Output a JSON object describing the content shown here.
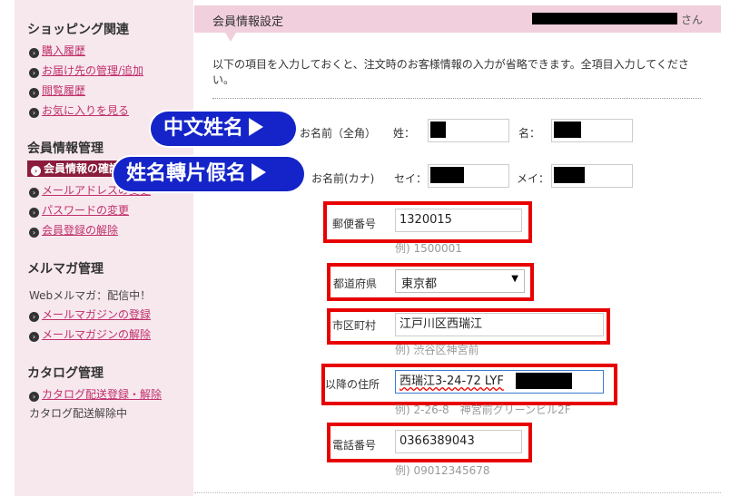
{
  "sidebar": {
    "shopping_title": "ショッピング関連",
    "shopping_links": [
      "購入履歴",
      "お届け先の管理/追加",
      "閲覧履歴",
      "お気に入りを見る"
    ],
    "member_title": "会員情報管理",
    "member_active": "会員情報の確認",
    "member_links": [
      "メールアドレスの変更",
      "パスワードの変更",
      "会員登録の解除"
    ],
    "mailmag_title": "メルマガ管理",
    "mailmag_status": "Webメルマガ：配信中！",
    "mailmag_links": [
      "メールマガジンの登録",
      "メールマガジンの解除"
    ],
    "catalog_title": "カタログ管理",
    "catalog_links": [
      "カタログ配送登録・解除"
    ],
    "catalog_status": "カタログ配送解除中"
  },
  "header": {
    "title": "会員情報設定",
    "san": "さん"
  },
  "intro": "以下の項目を入力しておくと、注文時のお客様情報の入力が省略できます。全項目入力してください。",
  "form": {
    "name_kanji": {
      "label": "お名前（全角）",
      "sei_label": "姓：",
      "mei_label": "名："
    },
    "name_kana": {
      "label": "お名前(カナ)",
      "sei_label": "セイ：",
      "mei_label": "メイ："
    },
    "postal": {
      "label": "郵便番号",
      "value": "1320015",
      "hint": "例) 1500001"
    },
    "prefecture": {
      "label": "都道府県",
      "value": "東京都"
    },
    "city": {
      "label": "市区町村",
      "value": "江戸川区西瑞江",
      "hint": "例) 渋谷区神宮前"
    },
    "address": {
      "label": "以降の住所",
      "value": "西瑞江3-24-72 LYF",
      "hint": "例) 2-26-8　神宮前グリーンビル2F"
    },
    "phone": {
      "label": "電話番号",
      "value": "0366389043",
      "hint": "例) 09012345678"
    }
  },
  "callouts": {
    "chinese_name": "中文姓名",
    "kana_name": "姓名轉片假名"
  },
  "colors": {
    "sidebar_bg": "#f7e8ee",
    "header_bg": "#f1cfdc",
    "link": "#c0306b",
    "active_bg": "#8a1c3c",
    "highlight_red": "#e80000",
    "callout_blue": "#1424c8"
  }
}
